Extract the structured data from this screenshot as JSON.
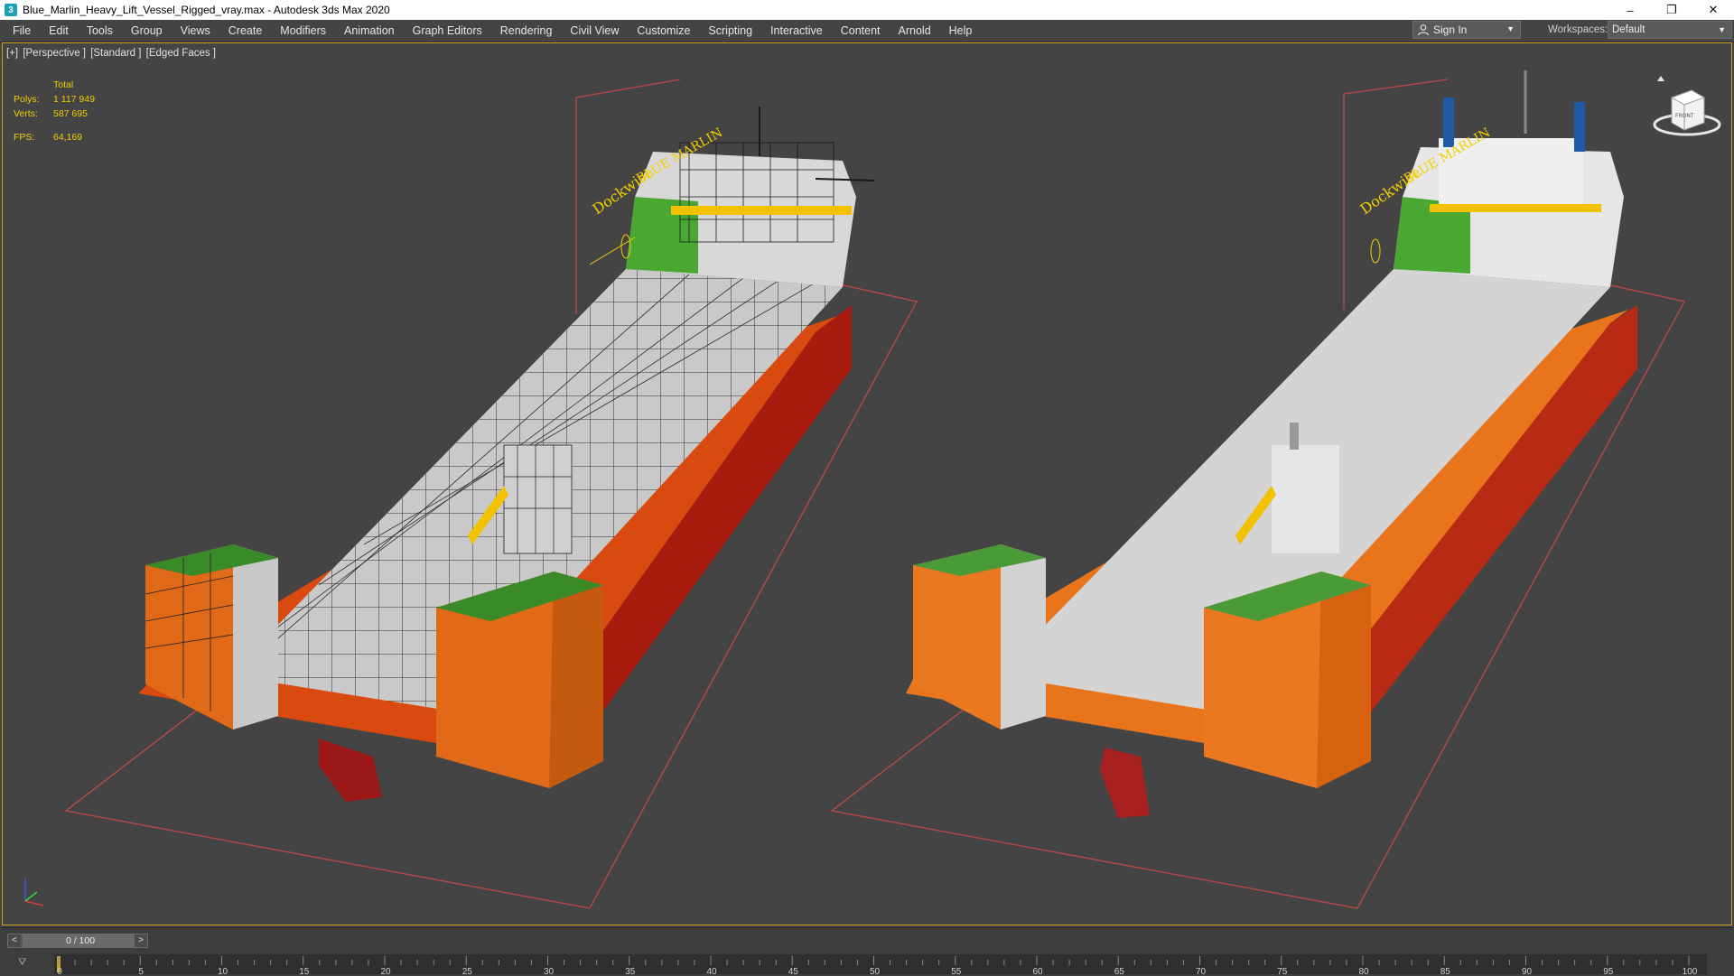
{
  "window": {
    "title": "Blue_Marlin_Heavy_Lift_Vessel_Rigged_vray.max - Autodesk 3ds Max 2020",
    "app_icon": "3",
    "controls": {
      "minimize": "–",
      "restore": "❐",
      "close": "✕"
    }
  },
  "menu": {
    "items": [
      "File",
      "Edit",
      "Tools",
      "Group",
      "Views",
      "Create",
      "Modifiers",
      "Animation",
      "Graph Editors",
      "Rendering",
      "Civil View",
      "Customize",
      "Scripting",
      "Interactive",
      "Content",
      "Arnold",
      "Help"
    ]
  },
  "account": {
    "signin_label": "Sign In",
    "caret": "▼"
  },
  "workspace": {
    "label": "Workspaces:",
    "value": "Default",
    "caret": "▼"
  },
  "viewport": {
    "label_parts": [
      "[+]",
      "[Perspective ]",
      "[Standard ]",
      "[Edged Faces ]"
    ],
    "stats": {
      "header": "Total",
      "polys_label": "Polys:",
      "polys_value": "1 117 949",
      "verts_label": "Verts:",
      "verts_value": "587 695",
      "fps_label": "FPS:",
      "fps_value": "64,169"
    },
    "viewcube_face": "FRONT",
    "overlay_color": "#f2d000",
    "selection_color": "#ff4040"
  },
  "timeline": {
    "frame_display": "0 / 100",
    "prev_arrow": "<",
    "next_arrow": ">",
    "tick_labels": [
      "0",
      "5",
      "10",
      "15",
      "20",
      "25",
      "30",
      "35",
      "40",
      "45",
      "50",
      "55",
      "60",
      "65",
      "70",
      "75",
      "80",
      "85",
      "90",
      "95",
      "100"
    ],
    "track_icon": "⛛"
  }
}
